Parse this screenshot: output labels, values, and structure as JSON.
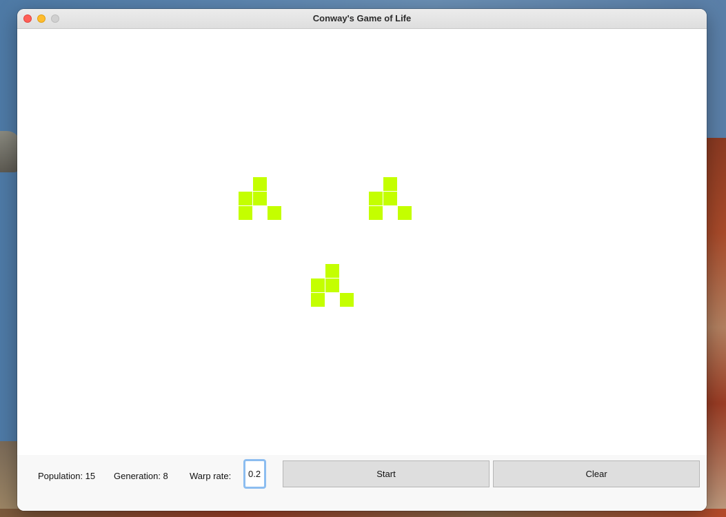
{
  "window": {
    "title": "Conway's Game of Life"
  },
  "board": {
    "cell_color": "#c4ff00",
    "live_cells": [
      [
        16,
        10
      ],
      [
        15,
        11
      ],
      [
        16,
        11
      ],
      [
        15,
        12
      ],
      [
        17,
        12
      ],
      [
        25,
        10
      ],
      [
        24,
        11
      ],
      [
        25,
        11
      ],
      [
        24,
        12
      ],
      [
        26,
        12
      ],
      [
        21,
        16
      ],
      [
        20,
        17
      ],
      [
        21,
        17
      ],
      [
        20,
        18
      ],
      [
        22,
        18
      ]
    ]
  },
  "controls": {
    "population": "Population: 15",
    "generation": "Generation: 8",
    "warp_label": "Warp rate:",
    "warp_value": "0.2",
    "start_label": "Start",
    "clear_label": "Clear"
  },
  "colors": {
    "focus_ring": "#8cbdf0",
    "button_bg": "#dedede"
  }
}
